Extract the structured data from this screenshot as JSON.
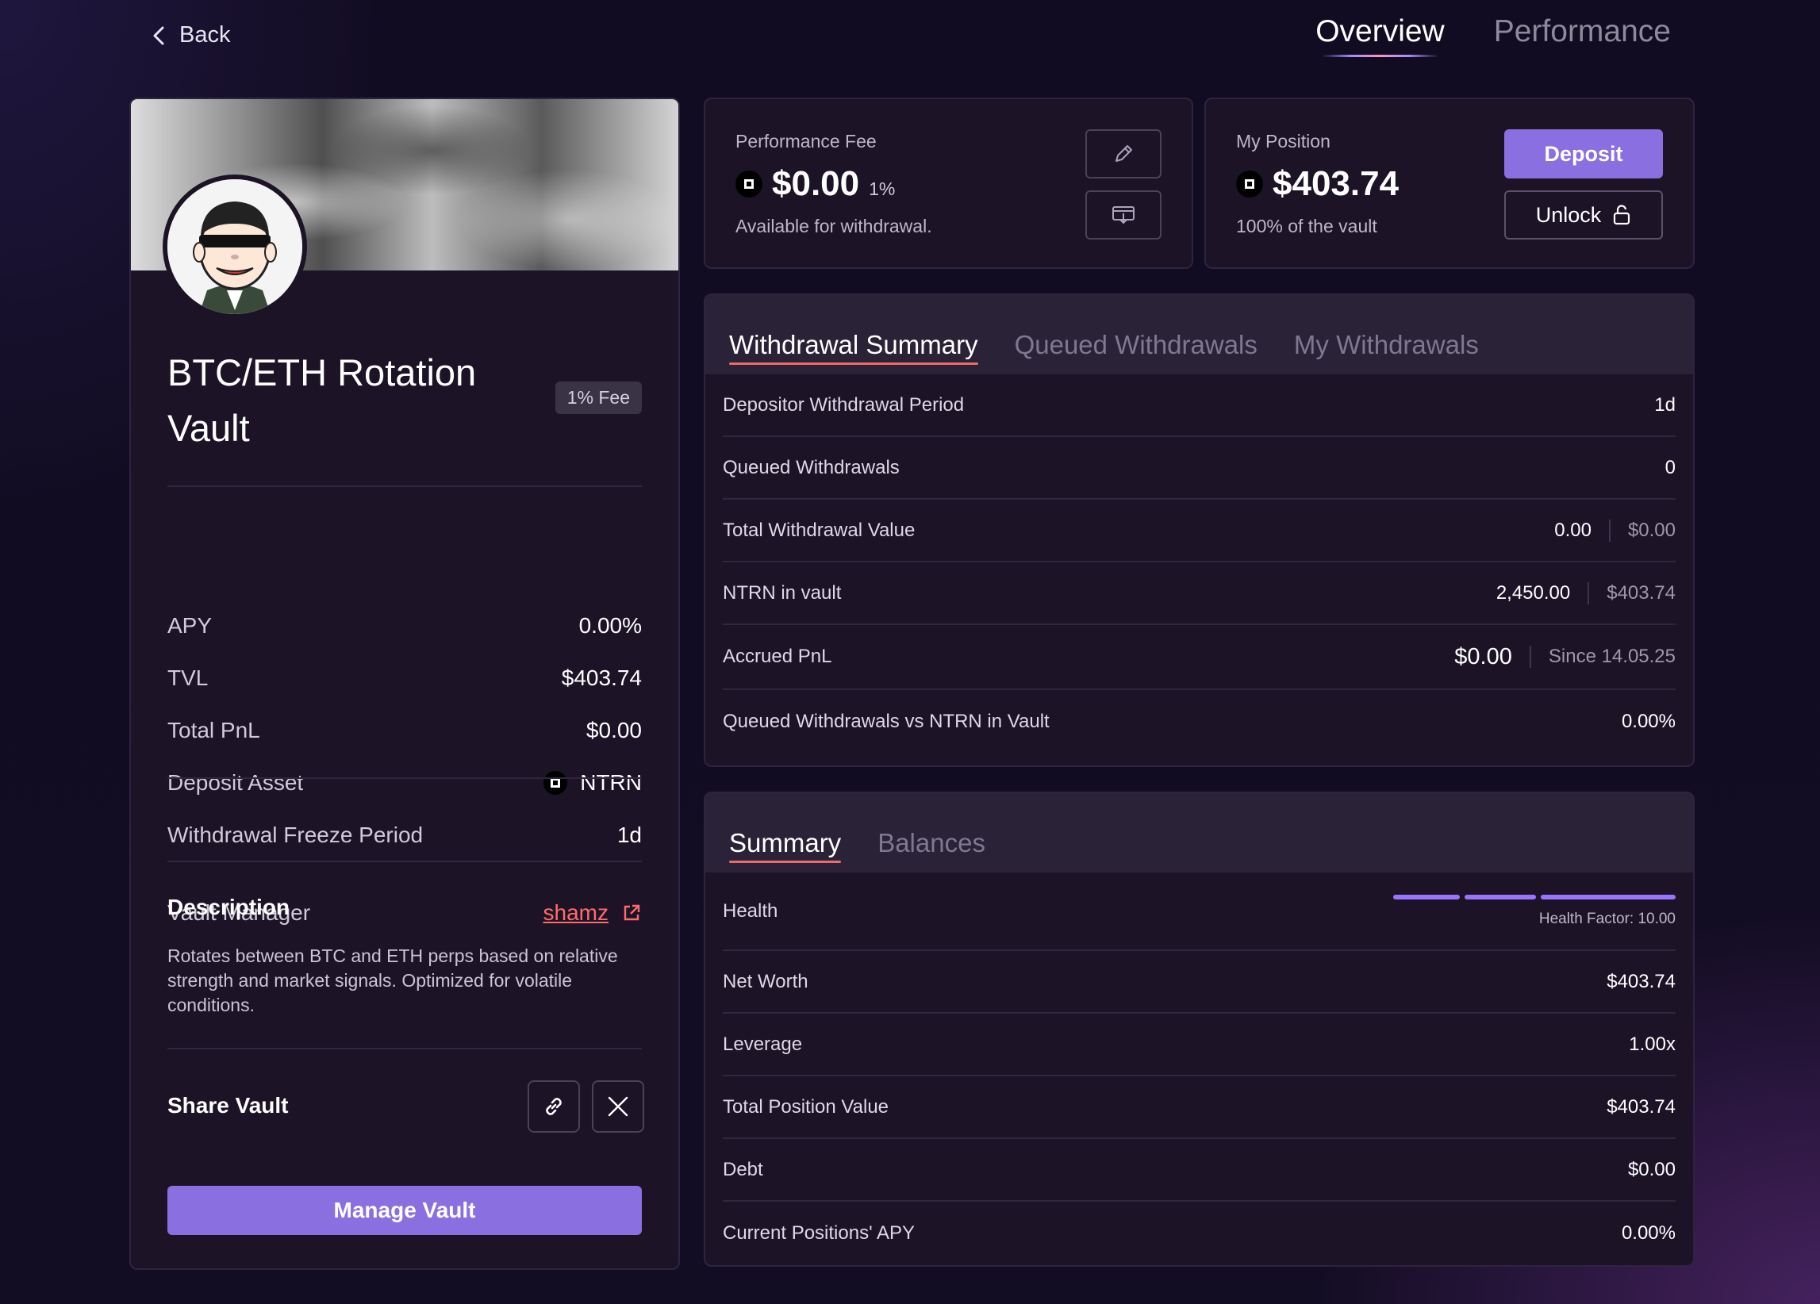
{
  "nav": {
    "back_label": "Back",
    "tabs": [
      {
        "label": "Overview",
        "active": true
      },
      {
        "label": "Performance",
        "active": false
      }
    ]
  },
  "vault": {
    "title": "BTC/ETH Rotation Vault",
    "fee_badge": "1% Fee",
    "stats": [
      {
        "label": "APY",
        "value": "0.00%"
      },
      {
        "label": "TVL",
        "value": "$403.74"
      },
      {
        "label": "Total PnL",
        "value": "$0.00"
      },
      {
        "label": "Deposit Asset",
        "value": "NTRN"
      },
      {
        "label": "Withdrawal Freeze Period",
        "value": "1d"
      }
    ],
    "manager_label": "Vault Manager",
    "manager_name": "shamz",
    "description_heading": "Description",
    "description": "Rotates between BTC and ETH perps based on relative strength and market signals. Optimized for volatile conditions.",
    "share_label": "Share Vault",
    "manage_button": "Manage Vault"
  },
  "performance_fee": {
    "label": "Performance Fee",
    "value": "$0.00",
    "percent": "1%",
    "sub": "Available for withdrawal."
  },
  "position": {
    "label": "My Position",
    "value": "$403.74",
    "sub": "100% of the vault",
    "deposit_button": "Deposit",
    "unlock_button": "Unlock"
  },
  "withdrawal_panel": {
    "tabs": [
      {
        "label": "Withdrawal Summary",
        "active": true
      },
      {
        "label": "Queued Withdrawals",
        "active": false
      },
      {
        "label": "My Withdrawals",
        "active": false
      }
    ],
    "rows": [
      {
        "label": "Depositor Withdrawal Period",
        "value": "1d"
      },
      {
        "label": "Queued Withdrawals",
        "value": "0"
      },
      {
        "label": "Total Withdrawal Value",
        "value": "0.00",
        "secondary": "$0.00"
      },
      {
        "label": "NTRN in vault",
        "value": "2,450.00",
        "secondary": "$403.74"
      },
      {
        "label": "Accrued PnL",
        "value": "$0.00",
        "secondary": "Since 14.05.25"
      },
      {
        "label": "Queued Withdrawals vs NTRN in Vault",
        "value": "0.00%"
      }
    ]
  },
  "summary_panel": {
    "tabs": [
      {
        "label": "Summary",
        "active": true
      },
      {
        "label": "Balances",
        "active": false
      }
    ],
    "health": {
      "label": "Health",
      "factor_text": "Health Factor: 10.00"
    },
    "rows": [
      {
        "label": "Net Worth",
        "value": "$403.74"
      },
      {
        "label": "Leverage",
        "value": "1.00x"
      },
      {
        "label": "Total Position Value",
        "value": "$403.74"
      },
      {
        "label": "Debt",
        "value": "$0.00"
      },
      {
        "label": "Current Positions' APY",
        "value": "0.00%"
      }
    ]
  },
  "colors": {
    "accent": "#8a6fe0",
    "link": "#ff6b6b",
    "tab_underline": "#ef6a6a",
    "health_bar": "#9a73ff"
  }
}
